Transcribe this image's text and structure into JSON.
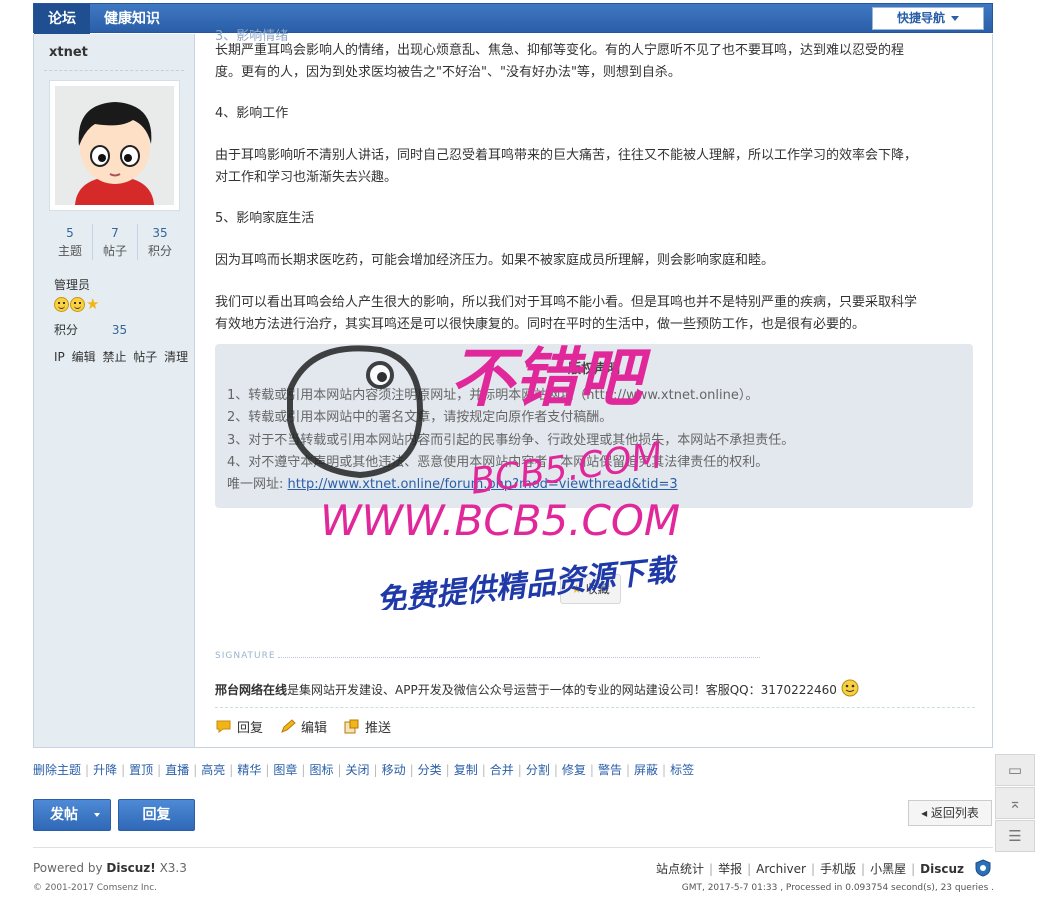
{
  "topbar": {
    "tabs": [
      "论坛",
      "健康知识"
    ],
    "quicknav": "快捷导航"
  },
  "user": {
    "name": "xtnet",
    "stats": [
      {
        "num": "5",
        "label": "主题"
      },
      {
        "num": "7",
        "label": "帖子"
      },
      {
        "num": "35",
        "label": "积分"
      }
    ],
    "group": "管理员",
    "points_label": "积分",
    "points_value": "35",
    "admin_links": [
      "IP",
      "编辑",
      "禁止",
      "帖子",
      "清理"
    ]
  },
  "post": {
    "paragraphs": [
      "3、影响情绪",
      "长期严重耳鸣会影响人的情绪，出现心烦意乱、焦急、抑郁等变化。有的人宁愿听不见了也不要耳鸣，达到难以忍受的程",
      "度。更有的人，因为到处求医均被告之\"不好治\"、\"没有好办法\"等，则想到自杀。",
      "4、影响工作",
      "由于耳鸣影响听不清别人讲话，同时自己忍受着耳鸣带来的巨大痛苦，往往又不能被人理解，所以工作学习的效率会下降，",
      "对工作和学习也渐渐失去兴趣。",
      "5、影响家庭生活",
      "因为耳鸣而长期求医吃药，可能会增加经济压力。如果不被家庭成员所理解，则会影响家庭和睦。",
      "我们可以看出耳鸣会给人产生很大的影响，所以我们对于耳鸣不能小看。但是耳鸣也并不是特别严重的疾病，只要采取科学",
      "有效地方法进行治疗，其实耳鸣还是可以很快康复的。同时在平时的生活中，做一些预防工作，也是很有必要的。"
    ]
  },
  "notice": {
    "title": "版权声明",
    "lines": [
      "1、转载或引用本网站内容须注明原网址，并标明本网站网址（http://www.xtnet.online）。",
      "2、转载或引用本网站中的署名文章，请按规定向原作者支付稿酬。",
      "3、对于不当转载或引用本网站内容而引起的民事纷争、行政处理或其他损失，本网站不承担责任。",
      "4、对不遵守本声明或其他违法、恶意使用本网站内容者，本网站保留追究其法律责任的权利。"
    ],
    "url_label": "唯一网址:",
    "url": "http://www.xtnet.online/forum.php?mod=viewthread&tid=3"
  },
  "favorite": "收藏",
  "signature": {
    "head": "SIGNATURE",
    "bold": "邢台网络在线",
    "text": "是集网站开发建设、APP开发及微信公众号运营于一体的专业的网站建设公司！客服QQ：3170222460"
  },
  "actions": [
    "回复",
    "编辑",
    "推送"
  ],
  "modbar": [
    "删除主题",
    "升降",
    "置顶",
    "直播",
    "高亮",
    "精华",
    "图章",
    "图标",
    "关闭",
    "移动",
    "分类",
    "复制",
    "合并",
    "分割",
    "修复",
    "警告",
    "屏蔽",
    "标签"
  ],
  "buttons": {
    "post": "发帖",
    "reply": "回复",
    "back": "返回列表"
  },
  "footer": {
    "powered_prefix": "Powered by",
    "powered_brand": "Discuz!",
    "powered_version": "X3.3",
    "copyright": "© 2001-2017 Comsenz Inc.",
    "links": [
      "站点统计",
      "举报",
      "Archiver",
      "手机版",
      "小黑屋"
    ],
    "brand": "Discuz",
    "gmt": "GMT, 2017-5-7 01:33 , Processed in 0.093754 second(s), 23 queries ."
  },
  "watermark": {
    "line1": "不错吧",
    "line2": "WWW.BCB5.COM",
    "line3": "免费提供精品资源下载"
  },
  "colors": {
    "nav_blue": "#2a5fa8",
    "sidebar_bg": "#e5edf2",
    "watermark_pink": "#e0289a"
  }
}
